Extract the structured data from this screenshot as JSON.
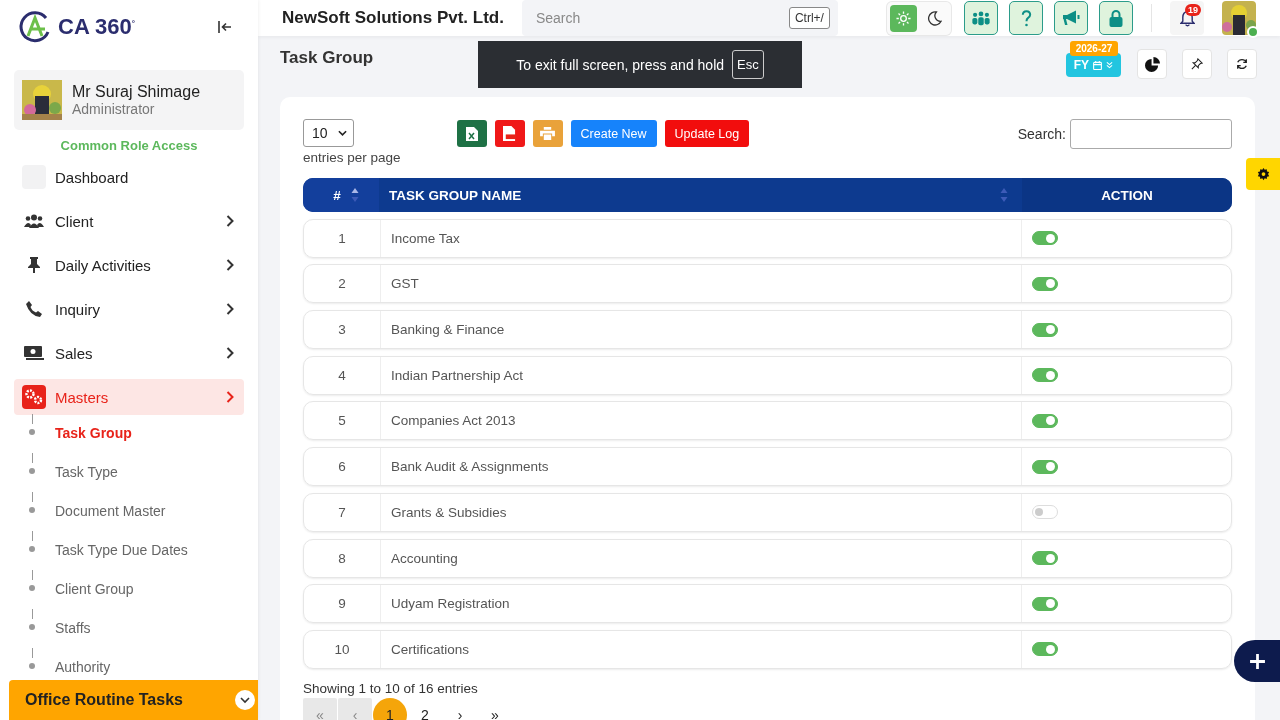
{
  "brand": {
    "name": "CA 360",
    "mark": "°"
  },
  "user": {
    "name": "Mr Suraj Shimage",
    "role": "Administrator"
  },
  "role_access": "Common Role Access",
  "sidebar": {
    "items": [
      {
        "label": "Dashboard",
        "expandable": false,
        "selected": false
      },
      {
        "label": "Client",
        "expandable": true,
        "selected": false
      },
      {
        "label": "Daily Activities",
        "expandable": true,
        "selected": false
      },
      {
        "label": "Inquiry",
        "expandable": true,
        "selected": false
      },
      {
        "label": "Sales",
        "expandable": true,
        "selected": false
      },
      {
        "label": "Masters",
        "expandable": true,
        "selected": true,
        "children": [
          {
            "label": "Task Group",
            "selected": true
          },
          {
            "label": "Task Type",
            "selected": false
          },
          {
            "label": "Document Master",
            "selected": false
          },
          {
            "label": "Task Type Due Dates",
            "selected": false
          },
          {
            "label": "Client Group",
            "selected": false
          },
          {
            "label": "Staffs",
            "selected": false
          },
          {
            "label": "Authority",
            "selected": false
          }
        ]
      }
    ],
    "footer": "Office Routine Tasks"
  },
  "header": {
    "company": "NewSoft Solutions Pvt. Ltd.",
    "search": {
      "placeholder": "Search",
      "shortcut": "Ctrl+/"
    },
    "theme": [
      {
        "kind": "light",
        "selected": true
      },
      {
        "kind": "dark",
        "selected": false
      }
    ],
    "notifications": "19"
  },
  "fullscreen_notice": {
    "text": "To exit full screen, press and hold",
    "key": "Esc"
  },
  "page": {
    "title": "Task Group",
    "fy": {
      "label": "FY",
      "year": "2026-27"
    }
  },
  "toolbar": {
    "page_size": "10",
    "page_size_label": "entries per page",
    "create": "Create New",
    "log": "Update Log",
    "search_label": "Search:"
  },
  "table": {
    "columns": [
      "#",
      "TASK GROUP NAME",
      "ACTION"
    ],
    "rows": [
      {
        "no": "1",
        "name": "Income Tax",
        "on": true
      },
      {
        "no": "2",
        "name": "GST",
        "on": true
      },
      {
        "no": "3",
        "name": "Banking & Finance",
        "on": true
      },
      {
        "no": "4",
        "name": "Indian Partnership Act",
        "on": true
      },
      {
        "no": "5",
        "name": "Companies Act 2013",
        "on": true
      },
      {
        "no": "6",
        "name": "Bank Audit & Assignments",
        "on": true
      },
      {
        "no": "7",
        "name": "Grants & Subsidies",
        "on": false
      },
      {
        "no": "8",
        "name": "Accounting",
        "on": true
      },
      {
        "no": "9",
        "name": "Udyam Registration",
        "on": true
      },
      {
        "no": "10",
        "name": "Certifications",
        "on": true
      }
    ]
  },
  "summary": "Showing 1 to 10 of 16 entries",
  "pagination": [
    {
      "label": "«",
      "selected": false,
      "disabled": true
    },
    {
      "label": "‹",
      "selected": false,
      "disabled": true
    },
    {
      "label": "1",
      "selected": true,
      "disabled": false
    },
    {
      "label": "2",
      "selected": false,
      "disabled": false
    },
    {
      "label": "›",
      "selected": false,
      "disabled": false
    },
    {
      "label": "»",
      "selected": false,
      "disabled": false
    }
  ]
}
